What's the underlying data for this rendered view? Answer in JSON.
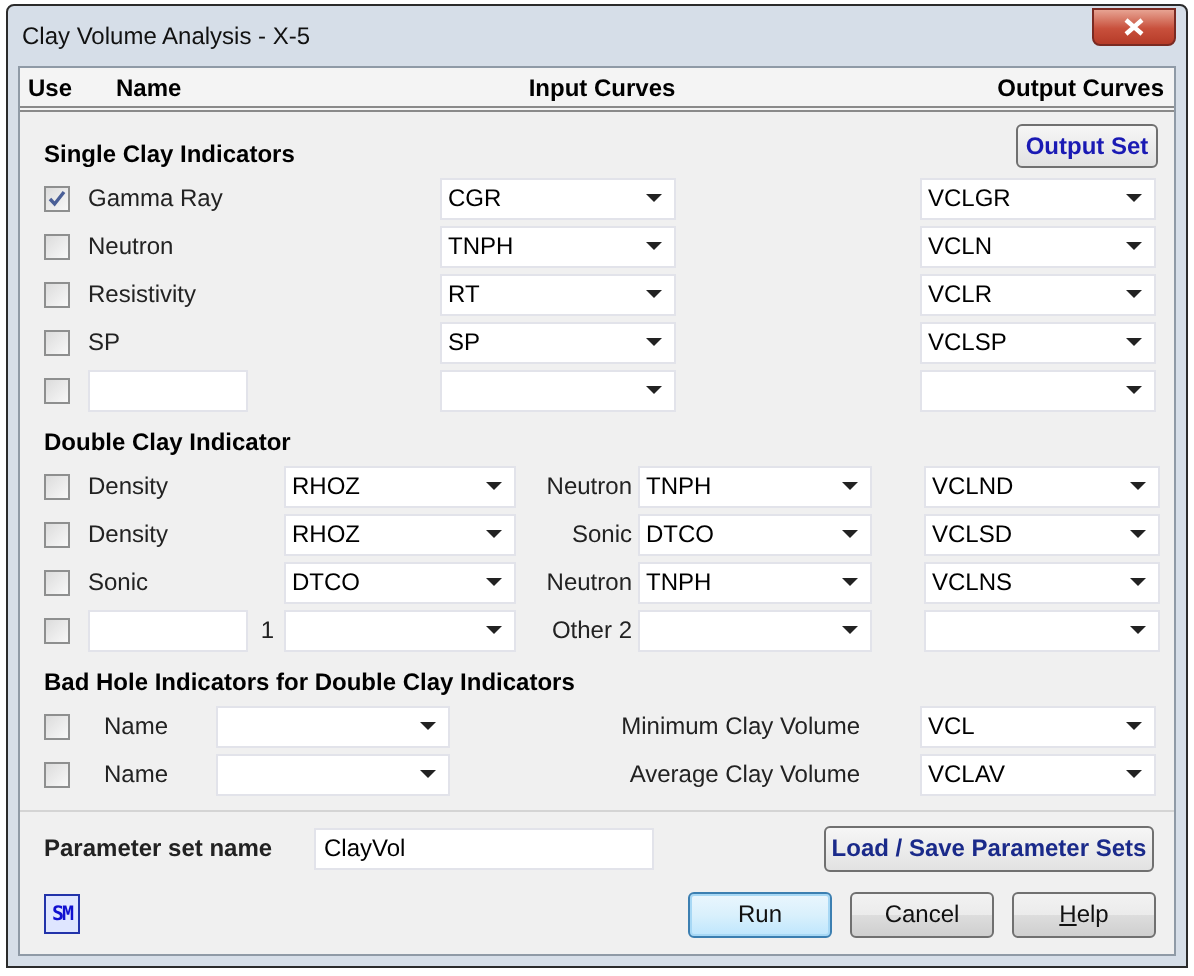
{
  "window": {
    "title": "Clay Volume Analysis - X-5"
  },
  "columns": [
    "Use",
    "Name",
    "Input Curves",
    "Output Curves"
  ],
  "single": {
    "title": "Single Clay Indicators",
    "output_set": "Output Set",
    "rows": [
      {
        "kind": "label",
        "checked": true,
        "name": "Gamma Ray",
        "input": "CGR",
        "output": "VCLGR"
      },
      {
        "kind": "label",
        "checked": false,
        "name": "Neutron",
        "input": "TNPH",
        "output": "VCLN"
      },
      {
        "kind": "label",
        "checked": false,
        "name": "Resistivity",
        "input": "RT",
        "output": "VCLR"
      },
      {
        "kind": "label",
        "checked": false,
        "name": "SP",
        "input": "SP",
        "output": "VCLSP"
      },
      {
        "kind": "blank",
        "checked": false
      }
    ]
  },
  "double": {
    "title": "Double Clay Indicator",
    "rows": [
      {
        "kind": "label",
        "checked": false,
        "name": "Density",
        "input_1": "RHOZ",
        "label_2": "Neutron",
        "input_2": "TNPH",
        "output": "VCLND"
      },
      {
        "kind": "label",
        "checked": false,
        "name": "Density",
        "input_1": "RHOZ",
        "label_2": "Sonic",
        "input_2": "DTCO",
        "output": "VCLSD"
      },
      {
        "kind": "label",
        "checked": false,
        "name": "Sonic",
        "input_1": "DTCO",
        "label_2": "Neutron",
        "input_2": "TNPH",
        "output": "VCLNS"
      },
      {
        "kind": "blank",
        "checked": false,
        "label_1": "1",
        "label_2": "Other 2"
      }
    ]
  },
  "bad_hole": {
    "title": "Bad Hole Indicators for Double Clay Indicators",
    "rows": [
      {
        "checked": false,
        "name": "Name",
        "label": "Minimum Clay Volume",
        "output": "VCL"
      },
      {
        "checked": false,
        "name": "Name",
        "label": "Average Clay Volume",
        "output": "VCLAV"
      }
    ]
  },
  "parameter_set": {
    "label": "Parameter set name",
    "value": "ClayVol",
    "button": "Load / Save Parameter Sets"
  },
  "logo": "SM",
  "buttons": [
    {
      "label": "Run",
      "default": true
    },
    {
      "label": "Cancel",
      "default": false
    },
    {
      "label": "Help",
      "default": false
    }
  ]
}
